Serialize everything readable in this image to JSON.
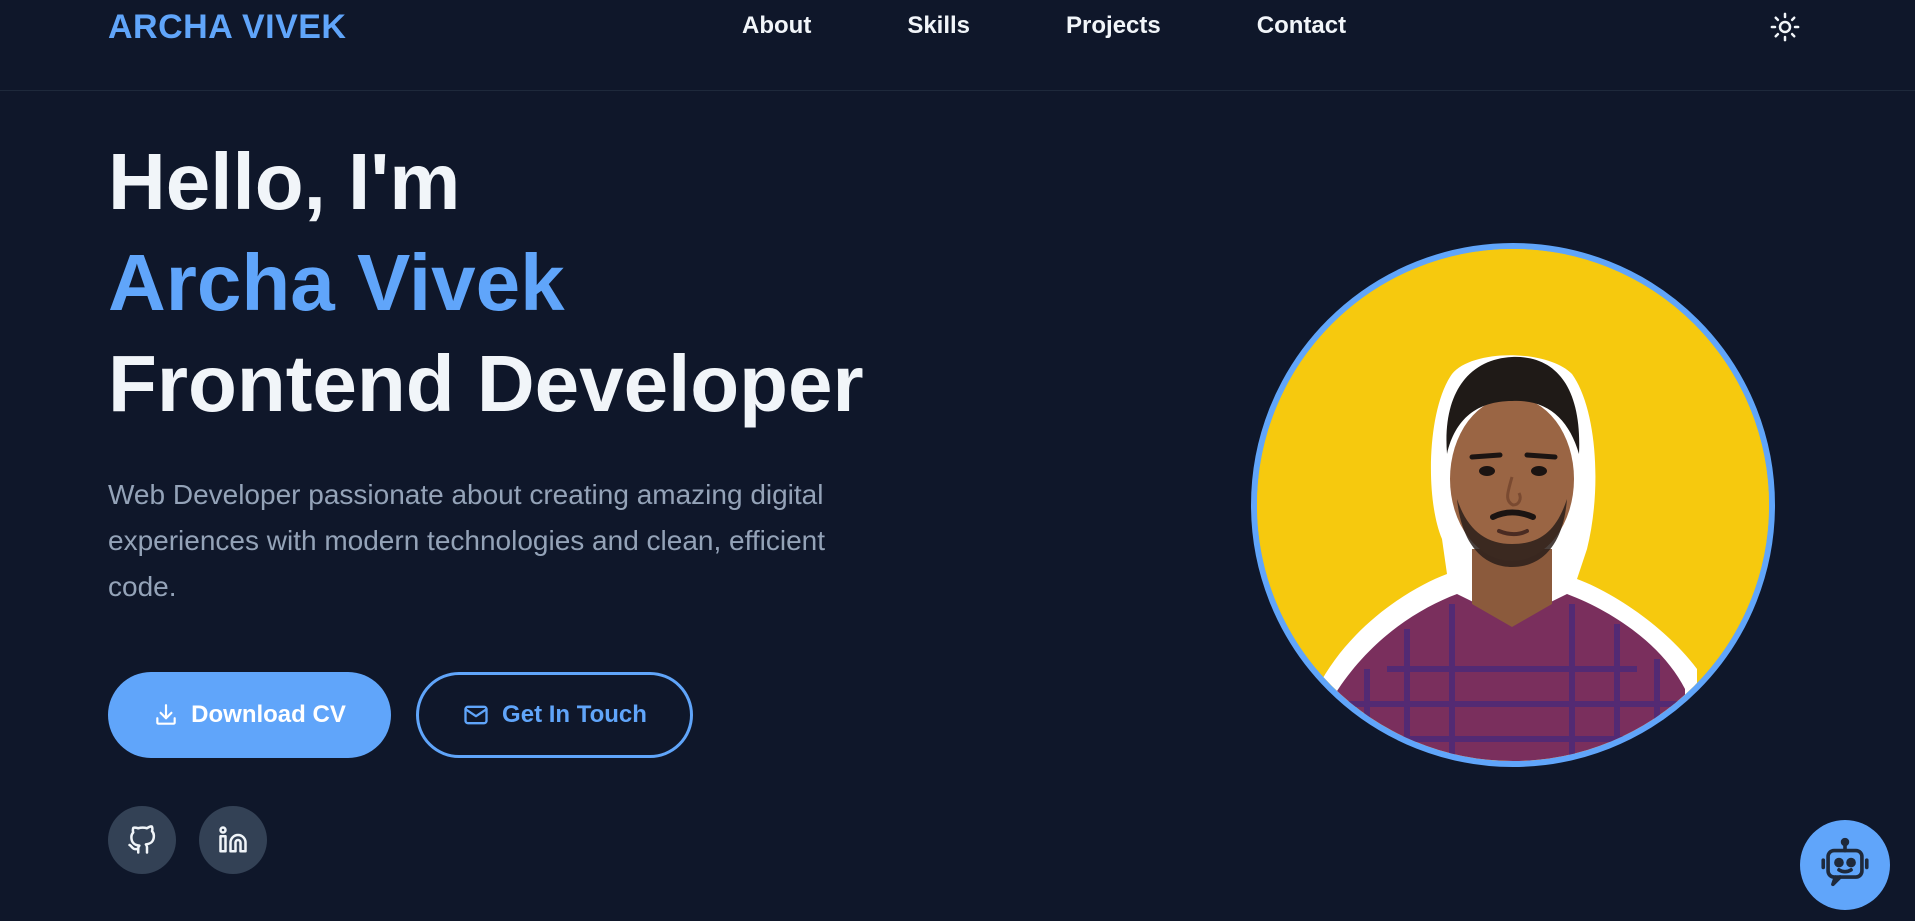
{
  "header": {
    "brand": "ARCHA VIVEK",
    "nav": [
      "About",
      "Skills",
      "Projects",
      "Contact"
    ],
    "theme_toggle_icon": "sun-icon"
  },
  "hero": {
    "greeting": "Hello, I'm",
    "name": "Archa Vivek",
    "role": "Frontend Developer",
    "description": "Web Developer passionate about creating amazing digital experiences with modern technologies and clean, efficient code.",
    "buttons": {
      "download_cv": "Download CV",
      "get_in_touch": "Get In Touch"
    },
    "social_icons": [
      "github-icon",
      "linkedin-icon"
    ]
  },
  "profile": {
    "background_color": "#f6c90e",
    "ring_color": "#60a5fa"
  },
  "chat": {
    "icon": "robot-icon"
  },
  "colors": {
    "background": "#0f172a",
    "accent": "#60a5fa",
    "text": "#f1f5f9",
    "muted": "#94a3b8",
    "social_bg": "#334155"
  }
}
